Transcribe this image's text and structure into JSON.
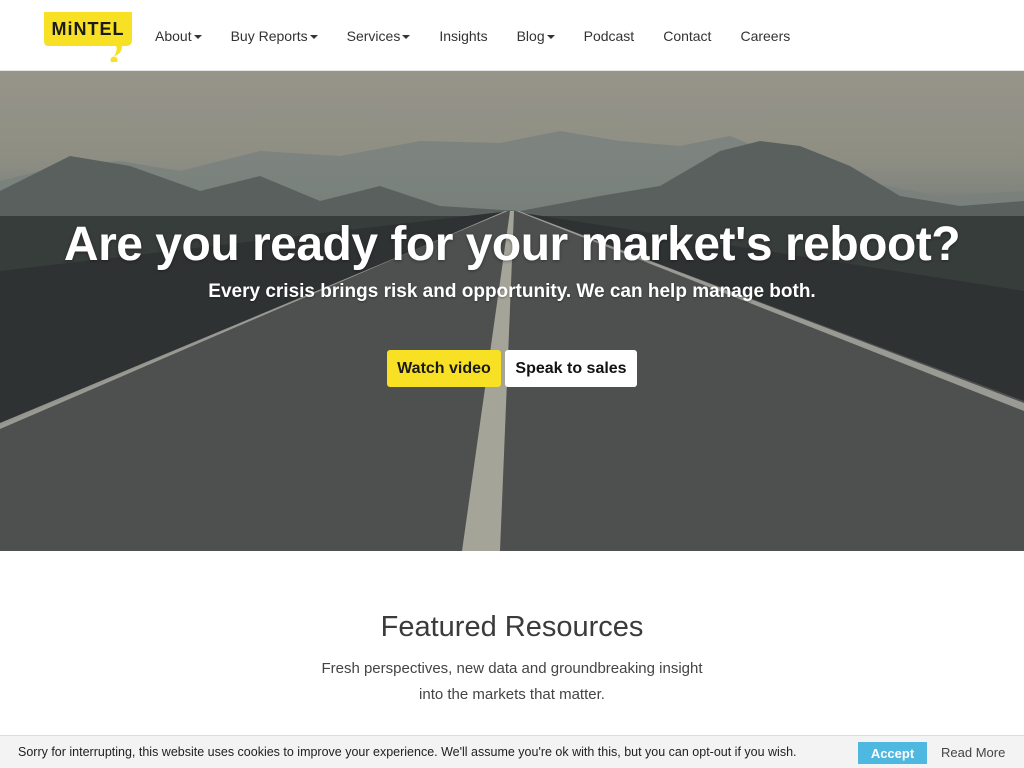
{
  "brand": {
    "logo_text": "MiNTEL",
    "logo_color": "#f8e024"
  },
  "nav": {
    "items": [
      {
        "label": "About",
        "dropdown": true
      },
      {
        "label": "Buy Reports",
        "dropdown": true
      },
      {
        "label": "Services",
        "dropdown": true
      },
      {
        "label": "Insights",
        "dropdown": false
      },
      {
        "label": "Blog",
        "dropdown": true
      },
      {
        "label": "Podcast",
        "dropdown": false
      },
      {
        "label": "Contact",
        "dropdown": false
      },
      {
        "label": "Careers",
        "dropdown": false
      }
    ]
  },
  "hero": {
    "title": "Are you ready for your market's reboot?",
    "subtitle": "Every crisis brings risk and opportunity. We can help manage both.",
    "watch_label": "Watch video",
    "sales_label": "Speak to sales"
  },
  "featured": {
    "title": "Featured Resources",
    "description_line1": "Fresh perspectives, new data and groundbreaking insight",
    "description_line2": "into the markets that matter."
  },
  "cookie": {
    "text": "Sorry for interrupting, this website uses cookies to improve your experience. We'll assume you're ok with this, but you can opt-out if you wish.",
    "accept_label": "Accept",
    "read_more_label": "Read More",
    "accept_color": "#4fb8e0"
  },
  "colors": {
    "accent": "#f8e024",
    "text": "#333333"
  }
}
